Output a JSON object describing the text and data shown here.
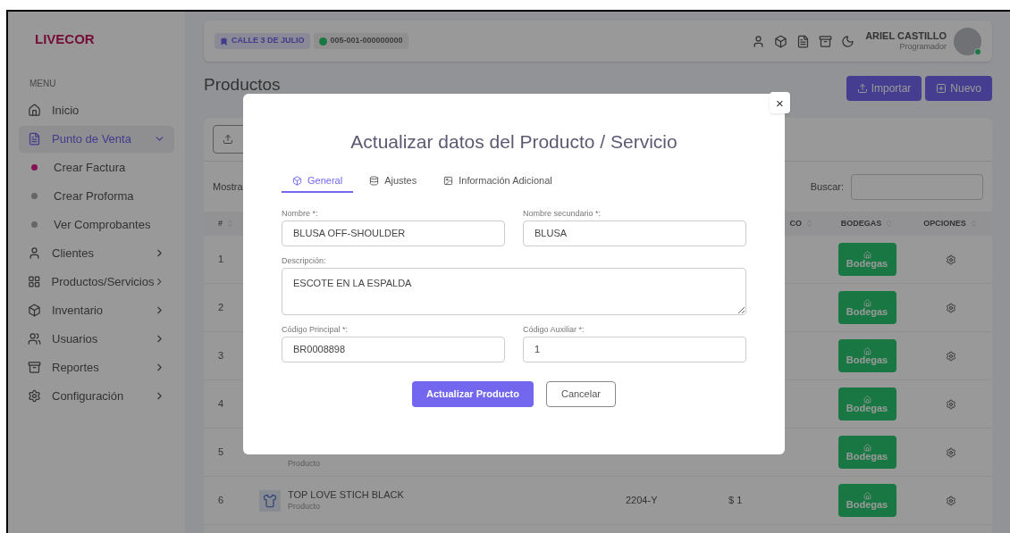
{
  "brand": "LIVECOR",
  "sidebar": {
    "section": "MENU",
    "items": [
      {
        "label": "Inicio",
        "kind": "link",
        "selected": false
      },
      {
        "label": "Punto de Venta",
        "kind": "group",
        "selected": true,
        "expanded": true,
        "children": [
          {
            "label": "Crear Factura",
            "selected": true
          },
          {
            "label": "Crear Proforma",
            "selected": false
          },
          {
            "label": "Ver Comprobantes",
            "selected": false
          }
        ]
      },
      {
        "label": "Clientes",
        "kind": "group",
        "selected": false,
        "expanded": false
      },
      {
        "label": "Productos/Servicios",
        "kind": "group",
        "selected": false,
        "expanded": false
      },
      {
        "label": "Inventario",
        "kind": "group",
        "selected": false,
        "expanded": false
      },
      {
        "label": "Usuarios",
        "kind": "group",
        "selected": false,
        "expanded": false
      },
      {
        "label": "Reportes",
        "kind": "group",
        "selected": false,
        "expanded": false
      },
      {
        "label": "Configuración",
        "kind": "group",
        "selected": false,
        "expanded": false
      }
    ]
  },
  "topbar": {
    "branch": "CALLE 3 DE JULIO",
    "point": "005-001-000000000",
    "point_online": true,
    "user": {
      "name": "ARIEL CASTILLO",
      "role": "Programador",
      "online": true
    }
  },
  "page": {
    "title": "Productos",
    "buttons": [
      "Importar",
      "Nuevo"
    ]
  },
  "table": {
    "show_label": "Mostra",
    "search_label": "Buscar:",
    "columns": [
      "#",
      "CO",
      "BODEGAS",
      "OPCIONES"
    ],
    "rows": [
      {
        "number": "1",
        "bodega": "Bodegas"
      },
      {
        "number": "2",
        "bodega": "Bodegas"
      },
      {
        "number": "3",
        "bodega": "Bodegas"
      },
      {
        "number": "4",
        "bodega": "Bodegas"
      },
      {
        "number": "5",
        "subtitle": "Producto",
        "bodega": "Bodegas"
      },
      {
        "number": "6",
        "name": "TOP LOVE STICH BLACK",
        "subtitle": "Producto",
        "code": "2204-Y",
        "price": "$ 1",
        "bodega": "Bodegas"
      }
    ]
  },
  "modal": {
    "title": "Actualizar datos del Producto / Servicio",
    "close": "×",
    "tabs": [
      {
        "label": "General",
        "selected": true
      },
      {
        "label": "Ajustes",
        "selected": false
      },
      {
        "label": "Información Adicional",
        "selected": false
      }
    ],
    "fields": [
      {
        "label": "Nombre *:",
        "value": "BLUSA OFF-SHOULDER",
        "kind": "input"
      },
      {
        "label": "Nombre secundario *:",
        "value": "BLUSA",
        "kind": "input"
      },
      {
        "label": "Descripción:",
        "value": "ESCOTE EN LA ESPALDA",
        "kind": "textarea"
      },
      {
        "label": "Código Principal *:",
        "value": "BR0008898",
        "kind": "input"
      },
      {
        "label": "Código Auxiliar *:",
        "value": "1",
        "kind": "input"
      }
    ],
    "submit": "Actualizar Producto",
    "cancel": "Cancelar"
  }
}
